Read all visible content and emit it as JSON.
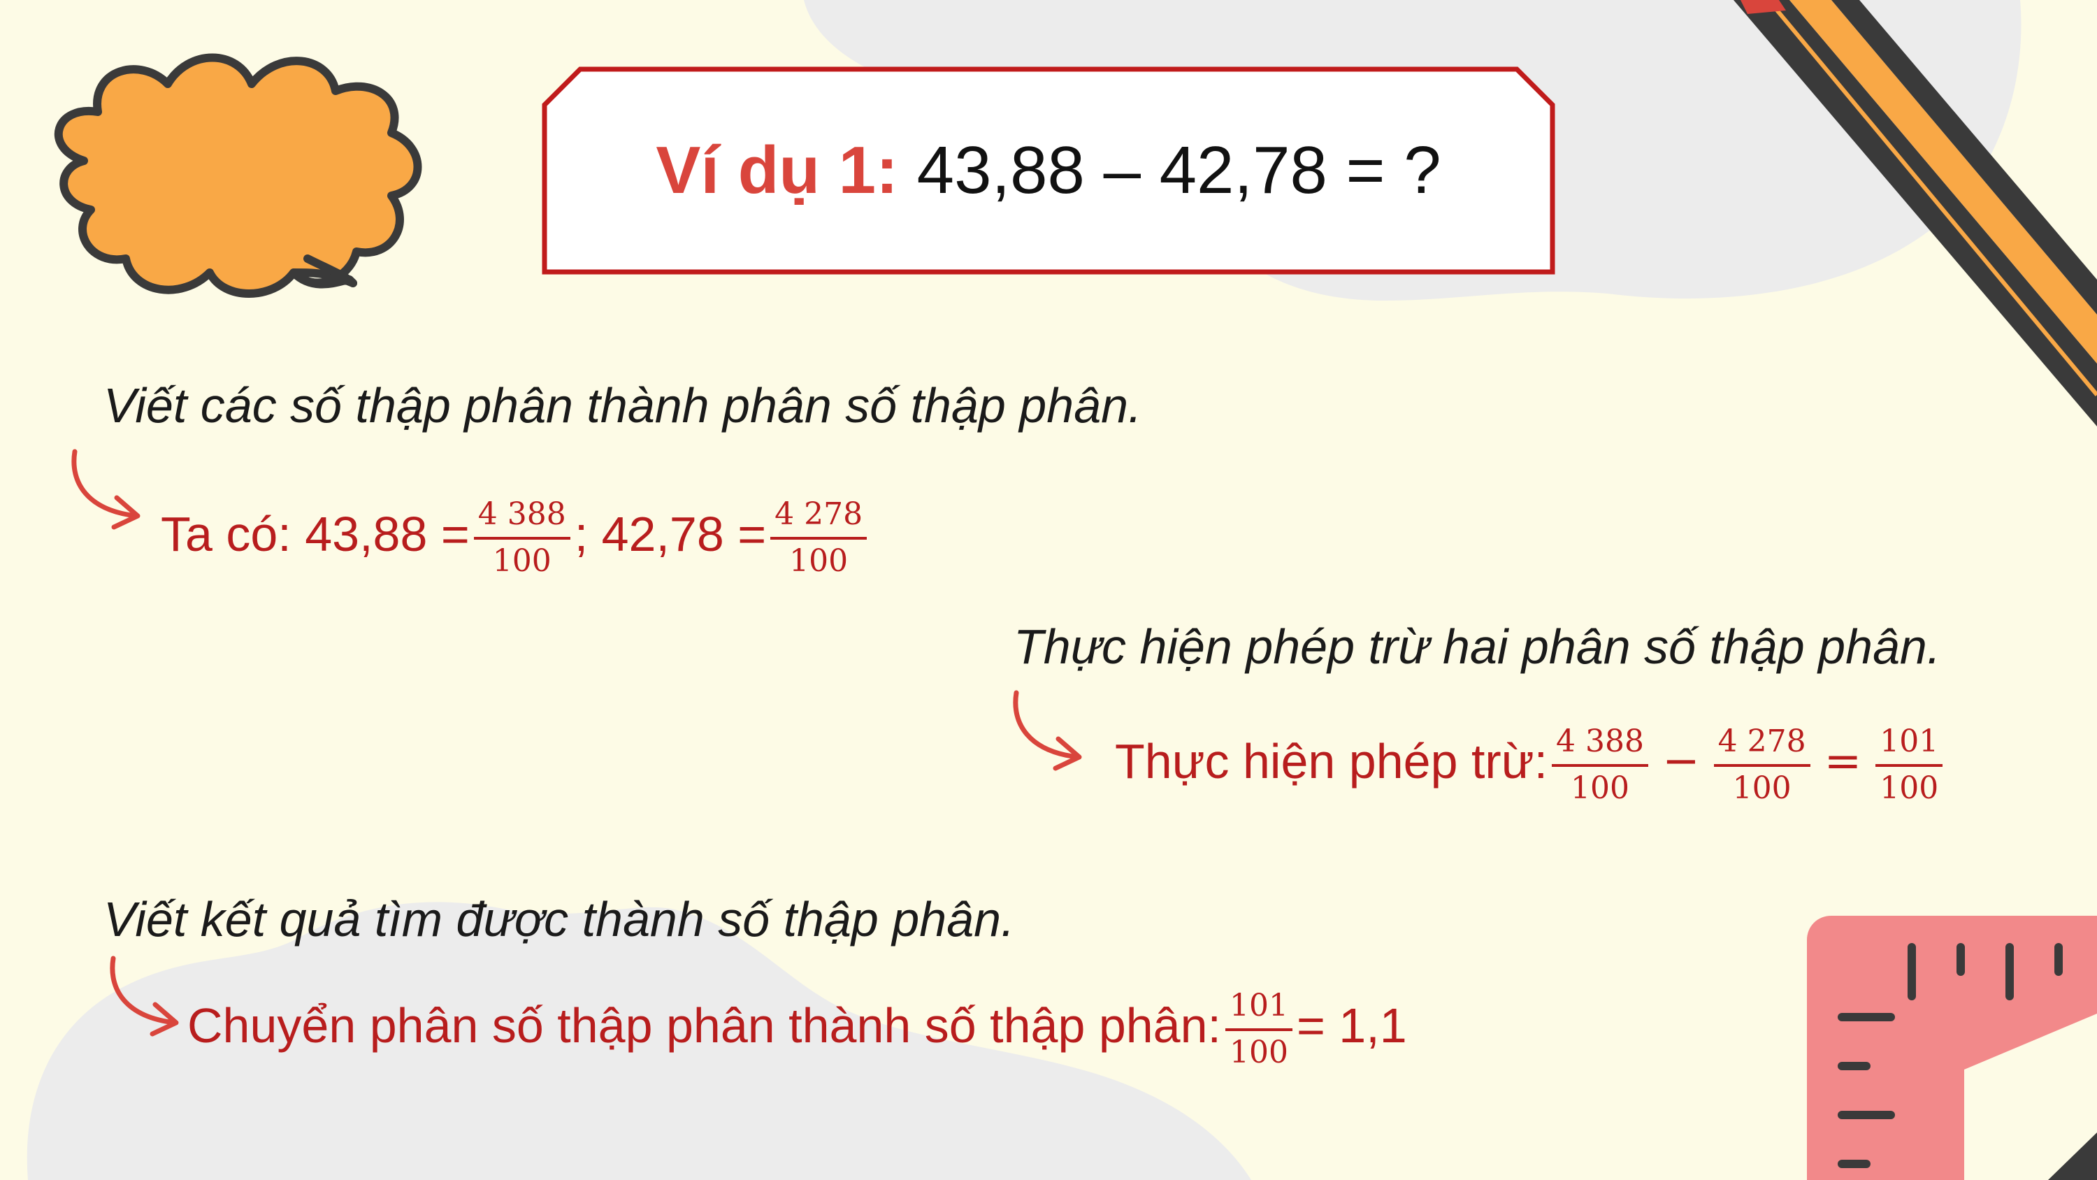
{
  "title": {
    "label": "Ví dụ 1:",
    "expression": "43,88 – 42,78 = ?"
  },
  "step1": {
    "instruction": "Viết các số thập phân thành phân số thập phân.",
    "lead": "Ta có: 43,88 = ",
    "frac1": {
      "num": "4 388",
      "den": "100"
    },
    "middle": "; 42,78 = ",
    "frac2": {
      "num": "4 278",
      "den": "100"
    }
  },
  "step2": {
    "instruction": "Thực hiện phép trừ hai phân số thập phân.",
    "lead": "Thực hiện phép trừ: ",
    "frac1": {
      "num": "4 388",
      "den": "100"
    },
    "op_minus": "−",
    "frac2": {
      "num": "4 278",
      "den": "100"
    },
    "op_equals": "=",
    "frac3": {
      "num": "101",
      "den": "100"
    }
  },
  "step3": {
    "instruction": "Viết kết quả tìm được thành số thập phân.",
    "lead": "Chuyển phân số thập phân thành số thập phân: ",
    "frac": {
      "num": "101",
      "den": "100"
    },
    "tail": " = 1,1"
  },
  "colors": {
    "background": "#fdfbe6",
    "accent_red": "#b81d1d",
    "title_red": "#d9453c",
    "cloud_orange": "#f9a846",
    "ruler_pink": "#f2898a"
  }
}
